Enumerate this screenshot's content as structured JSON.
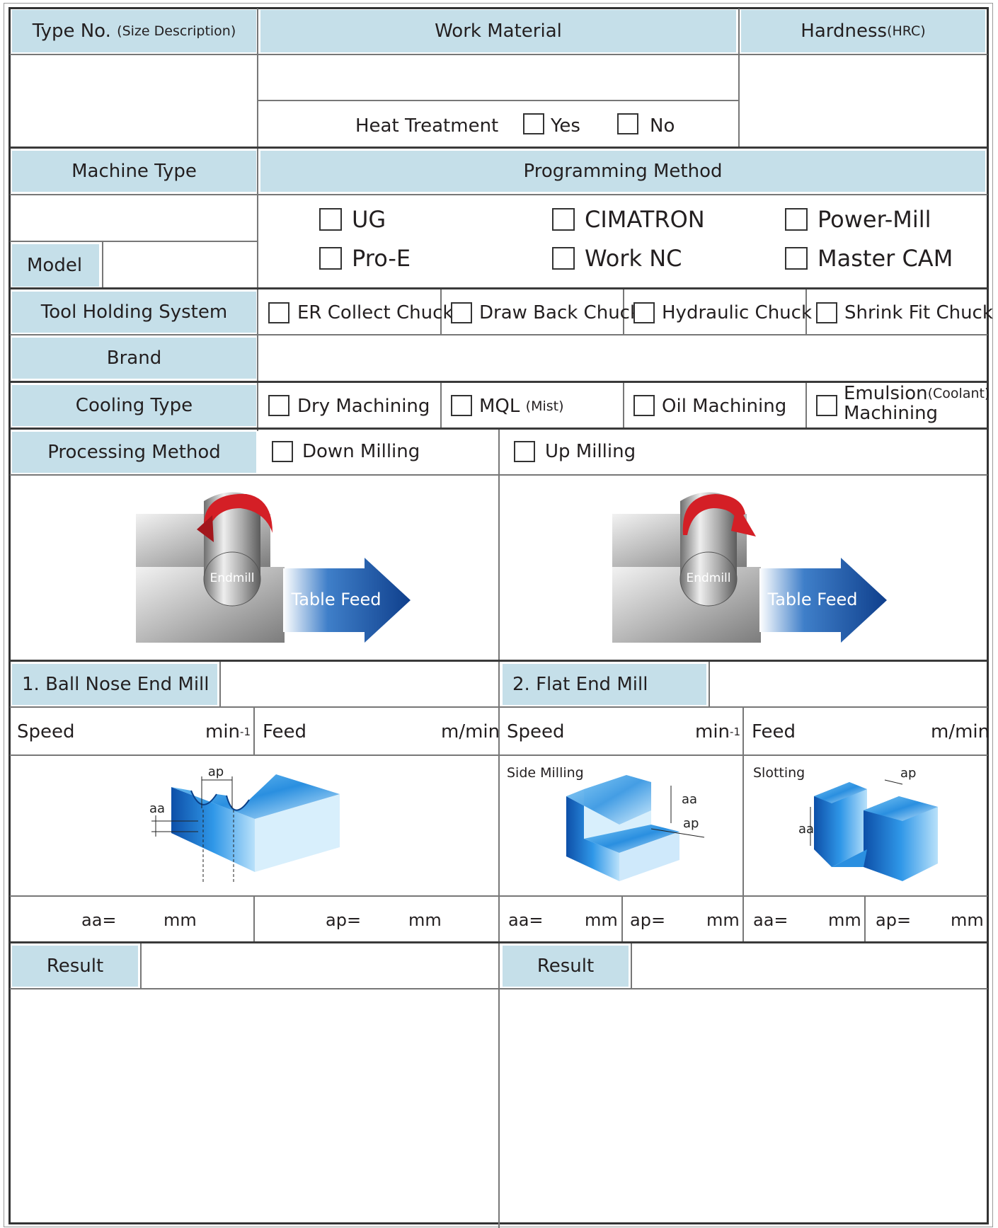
{
  "header": {
    "type_no": "Type No.",
    "type_no_sub": "(Size Description)",
    "work_material": "Work Material",
    "hardness": "Hardness",
    "hardness_sub": "(HRC)"
  },
  "heat_treatment": {
    "label": "Heat Treatment",
    "yes": "Yes",
    "no": "No"
  },
  "machine": {
    "machine_type": "Machine Type",
    "model": "Model"
  },
  "programming": {
    "label": "Programming Method",
    "options": [
      "UG",
      "CIMATRON",
      "Power-Mill",
      "Pro-E",
      "Work NC",
      "Master CAM"
    ]
  },
  "tool_holding": {
    "label": "Tool Holding System",
    "options": [
      "ER Collect Chuck",
      "Draw Back Chuck",
      "Hydraulic Chuck",
      "Shrink Fit Chuck"
    ]
  },
  "brand": {
    "label": "Brand"
  },
  "cooling": {
    "label": "Cooling Type",
    "dry": "Dry Machining",
    "mql": "MQL",
    "mql_sub": "(Mist)",
    "oil": "Oil Machining",
    "emulsion": "Emulsion",
    "emulsion_sub": "(Coolant)",
    "emulsion_line2": "Machining"
  },
  "processing": {
    "label": "Processing Method",
    "down": "Down Milling",
    "up": "Up Milling",
    "endmill": "Endmill",
    "table_feed": "Table Feed"
  },
  "ball_nose": {
    "title": "1. Ball Nose End Mill"
  },
  "flat_end": {
    "title": "2. Flat End Mill",
    "side_milling": "Side Milling",
    "slotting": "Slotting"
  },
  "params": {
    "speed": "Speed",
    "speed_unit": "min",
    "speed_exp": "-1",
    "feed": "Feed",
    "feed_unit": "m/min",
    "aa": "aa",
    "ap": "ap",
    "aa_eq": "aa=",
    "ap_eq": "ap=",
    "mm": "mm"
  },
  "result": {
    "label": "Result"
  },
  "colors": {
    "label_bg": "#c5dfe9",
    "line": "#3a3a3a",
    "arrow_blue": "#1d5aa8",
    "rotation_red": "#d41f26"
  }
}
